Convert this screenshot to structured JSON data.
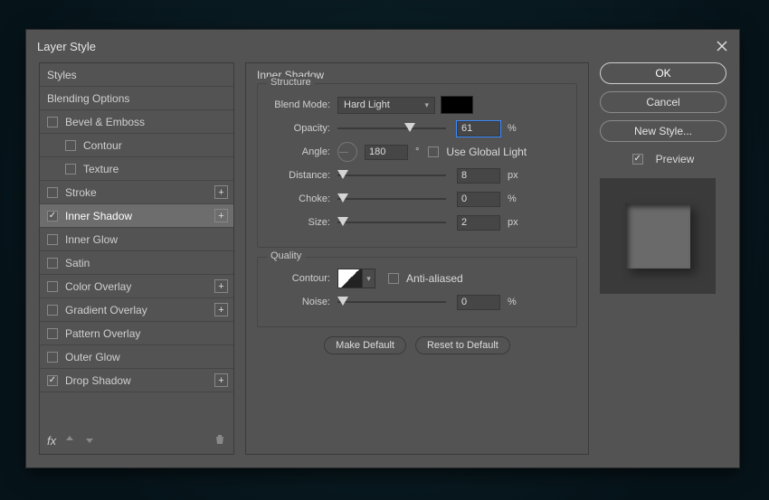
{
  "title": "Layer Style",
  "styles": {
    "header": "Styles",
    "blending": "Blending Options",
    "items": [
      {
        "label": "Bevel & Emboss",
        "checked": false,
        "plus": false
      },
      {
        "label": "Contour",
        "checked": false,
        "plus": false,
        "indent": true
      },
      {
        "label": "Texture",
        "checked": false,
        "plus": false,
        "indent": true
      },
      {
        "label": "Stroke",
        "checked": false,
        "plus": true
      },
      {
        "label": "Inner Shadow",
        "checked": true,
        "plus": true,
        "selected": true
      },
      {
        "label": "Inner Glow",
        "checked": false,
        "plus": false
      },
      {
        "label": "Satin",
        "checked": false,
        "plus": false
      },
      {
        "label": "Color Overlay",
        "checked": false,
        "plus": true
      },
      {
        "label": "Gradient Overlay",
        "checked": false,
        "plus": true
      },
      {
        "label": "Pattern Overlay",
        "checked": false,
        "plus": false
      },
      {
        "label": "Outer Glow",
        "checked": false,
        "plus": false
      },
      {
        "label": "Drop Shadow",
        "checked": true,
        "plus": true
      }
    ],
    "fx": "fx"
  },
  "settings": {
    "title": "Inner Shadow",
    "structure": {
      "legend": "Structure",
      "blend_mode_label": "Blend Mode:",
      "blend_mode": "Hard Light",
      "opacity_label": "Opacity:",
      "opacity": "61",
      "opacity_unit": "%",
      "angle_label": "Angle:",
      "angle": "180",
      "angle_unit": "°",
      "global_label": "Use Global Light",
      "distance_label": "Distance:",
      "distance": "8",
      "distance_unit": "px",
      "choke_label": "Choke:",
      "choke": "0",
      "choke_unit": "%",
      "size_label": "Size:",
      "size": "2",
      "size_unit": "px"
    },
    "quality": {
      "legend": "Quality",
      "contour_label": "Contour:",
      "aa_label": "Anti-aliased",
      "noise_label": "Noise:",
      "noise": "0",
      "noise_unit": "%"
    },
    "make_default": "Make Default",
    "reset_default": "Reset to Default"
  },
  "right": {
    "ok": "OK",
    "cancel": "Cancel",
    "new_style": "New Style...",
    "preview": "Preview"
  }
}
